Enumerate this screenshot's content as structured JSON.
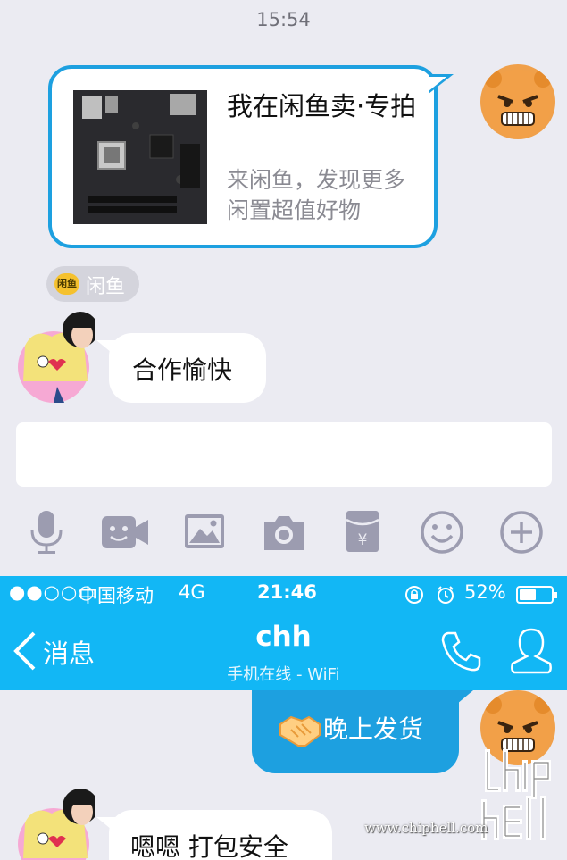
{
  "top_chat": {
    "timestamp": "15:54",
    "share_card": {
      "title": "我在闲鱼卖·专拍",
      "description": "来闲鱼，发现更多闲置超值好物"
    },
    "source_chip": {
      "icon": "xianyu-app-icon",
      "icon_text": "闲鱼",
      "label": "闲鱼"
    },
    "message_left": "合作愉快",
    "compose_value": "",
    "toolbar": [
      "microphone-icon",
      "video-icon",
      "image-icon",
      "camera-icon",
      "red-packet-icon",
      "emoji-icon",
      "plus-icon"
    ]
  },
  "status_bar": {
    "signal": "●●○○○",
    "carrier": "中国移动",
    "network": "4G",
    "time": "21:46",
    "battery": "52%",
    "battery_level": 0.52
  },
  "nav_bar": {
    "back_label": "消息",
    "contact_name": "chh",
    "contact_status": "手机在线 - WiFi"
  },
  "bottom_chat": {
    "message_right_emoji": "handshake-emoji",
    "message_right": "晚上发货",
    "message_left": "嗯嗯 打包安全"
  },
  "watermark": {
    "url": "www.chiphell.com",
    "logo_text": "chip hell"
  },
  "colors": {
    "accent": "#12b7f5",
    "bubble_blue": "#1da0e0",
    "background": "#ebebf2",
    "icon_gray": "#9c9cb0"
  }
}
